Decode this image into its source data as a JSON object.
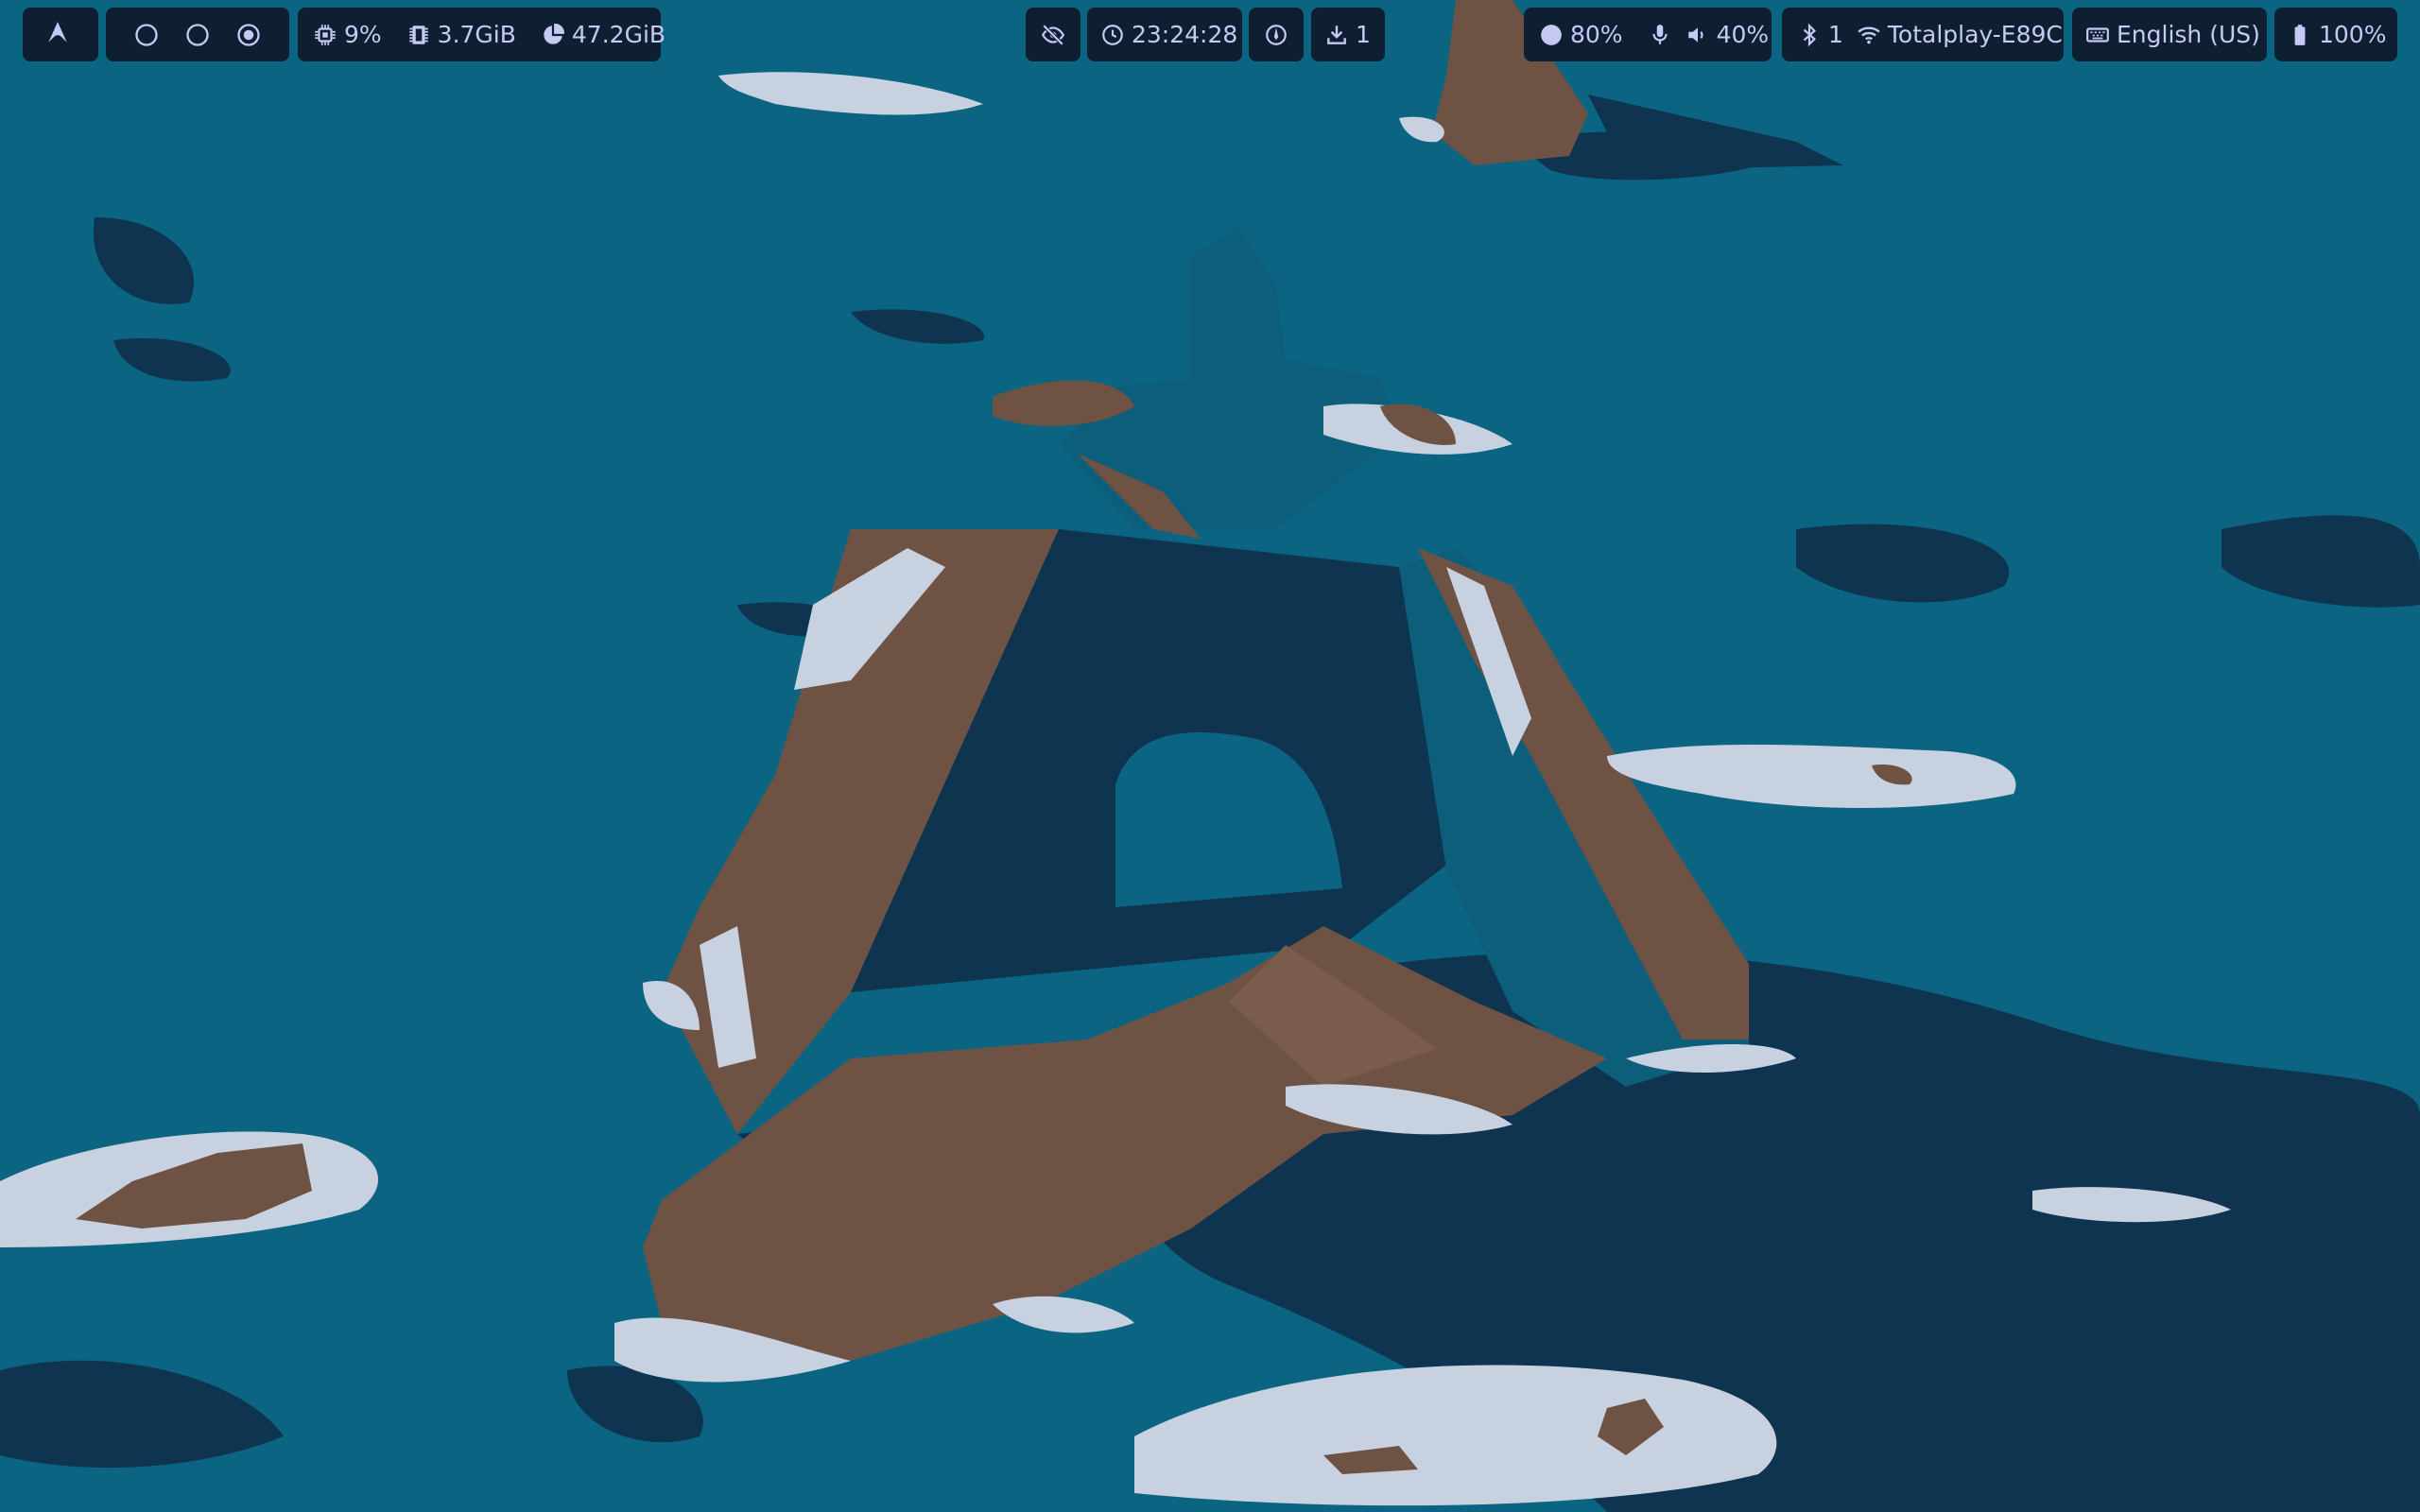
{
  "colors": {
    "pill_bg": "#0f1f32",
    "text": "#c6c9f4",
    "sea": "#0b6582",
    "sea_deep": "#0f3450",
    "rock": "#6e5244",
    "foam": "#c8d1e0"
  },
  "bar": {
    "launcher": {
      "icon": "arch-linux-icon"
    },
    "workspaces": [
      {
        "icon": "circle-outline-icon",
        "active": false
      },
      {
        "icon": "circle-outline-icon",
        "active": false
      },
      {
        "icon": "circle-dot-icon",
        "active": true
      }
    ],
    "system": {
      "cpu": {
        "icon": "cpu-icon",
        "value": "9%"
      },
      "memory": {
        "icon": "memory-icon",
        "value": "3.7GiB"
      },
      "disk": {
        "icon": "disk-pie-icon",
        "value": "47.2GiB"
      }
    },
    "center": {
      "idle_inhibitor": {
        "icon": "eye-off-icon"
      },
      "clock": {
        "icon": "clock-icon",
        "value": "23:24:28"
      },
      "power_profile": {
        "icon": "power-profile-icon"
      },
      "updates": {
        "icon": "download-icon",
        "value": "1"
      }
    },
    "audio": {
      "brightness": {
        "icon": "brightness-icon",
        "value": "80%"
      },
      "microphone": {
        "icon": "microphone-icon"
      },
      "volume": {
        "icon": "speaker-icon",
        "value": "40%"
      }
    },
    "network": {
      "bluetooth": {
        "icon": "bluetooth-icon",
        "value": "1"
      },
      "wifi": {
        "icon": "wifi-icon",
        "value": "Totalplay-E89C"
      }
    },
    "keyboard": {
      "icon": "keyboard-icon",
      "value": "English (US)"
    },
    "battery": {
      "icon": "battery-icon",
      "value": "100%"
    }
  }
}
